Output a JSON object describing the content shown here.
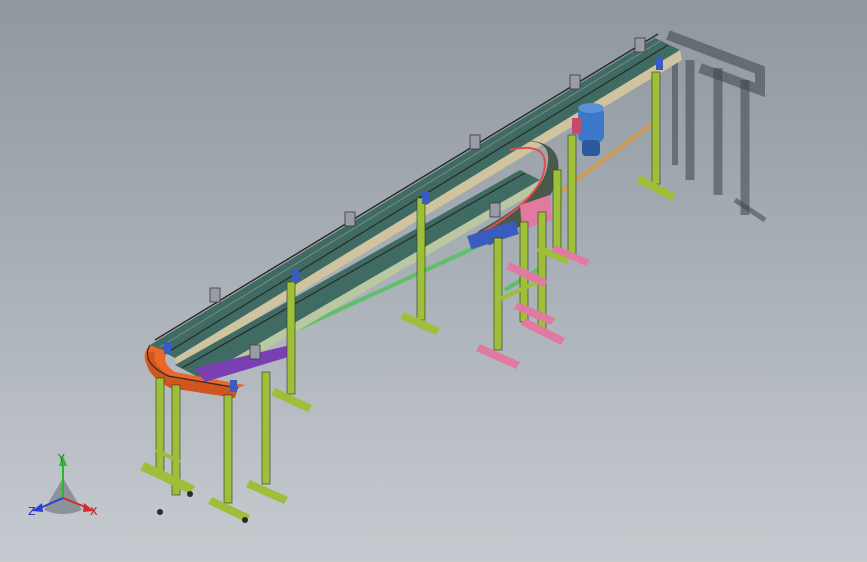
{
  "viewport": {
    "background_top": "#8f979f",
    "background_bottom": "#c6cbd0"
  },
  "model": {
    "frame_color": "#9dbf3a",
    "rail_color": "#3f6b63",
    "curve_color": "#e8672a",
    "foot_color": "#d9d27a",
    "pink_color": "#e07aa0",
    "blue_color": "#3a5bbf",
    "purple_color": "#7a3fb3",
    "tie_color": "#5fbf6a",
    "motor_color": "#3a78c9",
    "shadow_color": "#3e444a"
  },
  "triad": {
    "x_label": "X",
    "y_label": "Y",
    "z_label": "Z",
    "x_color": "#d62b2b",
    "y_color": "#2bb82b",
    "z_color": "#2b3fd6"
  }
}
